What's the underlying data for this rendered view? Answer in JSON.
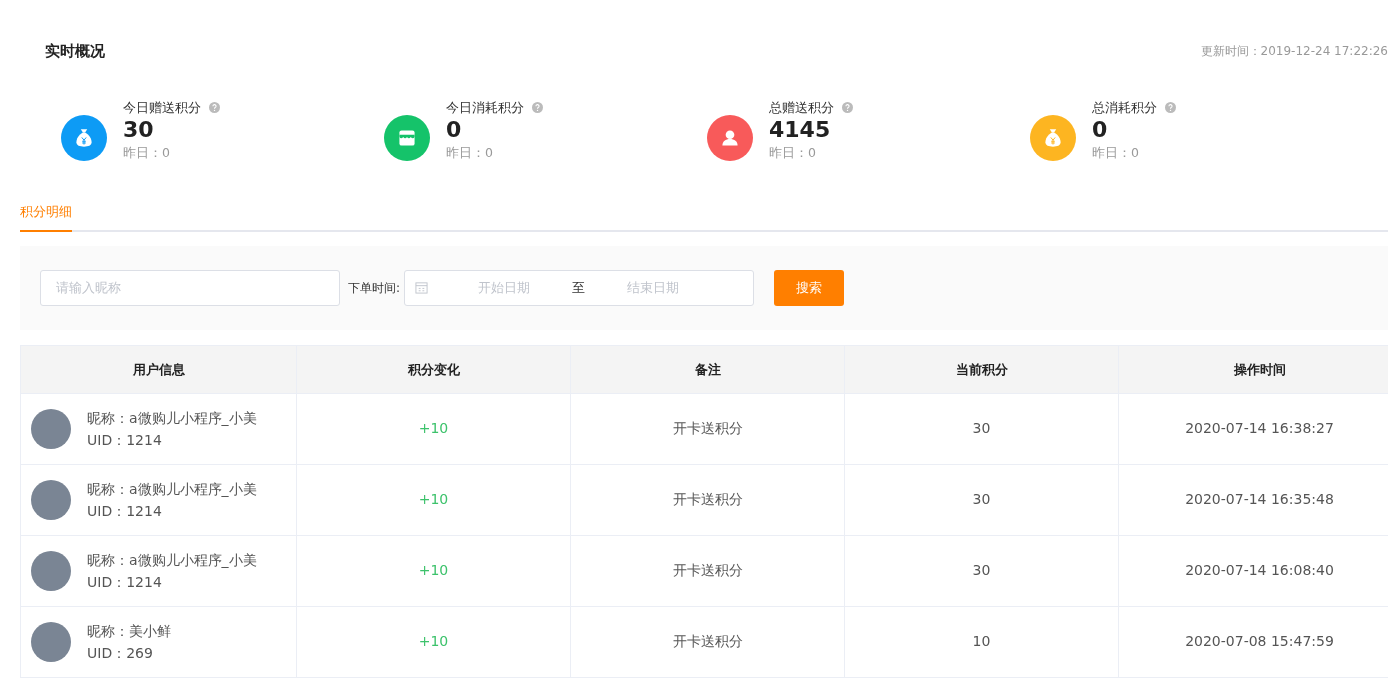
{
  "overview": {
    "title": "实时概况",
    "update_time": "更新时间：2019-12-24 17:22:26"
  },
  "stats": [
    {
      "kind": "moneybag",
      "color": "#0d9bf5",
      "label": "今日赠送积分",
      "value": "30",
      "yesterday": "昨日：0"
    },
    {
      "kind": "shop",
      "color": "#15c36a",
      "label": "今日消耗积分",
      "value": "0",
      "yesterday": "昨日：0"
    },
    {
      "kind": "person",
      "color": "#f85a5a",
      "label": "总赠送积分",
      "value": "4145",
      "yesterday": "昨日：0"
    },
    {
      "kind": "moneybag",
      "color": "#fdb521",
      "label": "总消耗积分",
      "value": "0",
      "yesterday": "昨日：0"
    }
  ],
  "tabs": [
    {
      "label": "积分明细",
      "selected": true
    }
  ],
  "filter": {
    "nickname": {
      "placeholder": "请输入昵称"
    },
    "date_label": "下单时间:",
    "start": {
      "placeholder": "开始日期"
    },
    "separator": "至",
    "end": {
      "placeholder": "结束日期"
    },
    "search_button": "搜索"
  },
  "table": {
    "columns": [
      "用户信息",
      "积分变化",
      "备注",
      "当前积分",
      "操作时间"
    ],
    "rows": [
      {
        "nickname": "昵称：a微购儿小程序_小美",
        "uid": "UID：1214",
        "change": "+10",
        "note": "开卡送积分",
        "points": "30",
        "time": "2020-07-14 16:38:27"
      },
      {
        "nickname": "昵称：a微购儿小程序_小美",
        "uid": "UID：1214",
        "change": "+10",
        "note": "开卡送积分",
        "points": "30",
        "time": "2020-07-14 16:35:48"
      },
      {
        "nickname": "昵称：a微购儿小程序_小美",
        "uid": "UID：1214",
        "change": "+10",
        "note": "开卡送积分",
        "points": "30",
        "time": "2020-07-14 16:08:40"
      },
      {
        "nickname": "昵称：美小鲜",
        "uid": "UID：269",
        "change": "+10",
        "note": "开卡送积分",
        "points": "10",
        "time": "2020-07-08 15:47:59"
      }
    ]
  }
}
